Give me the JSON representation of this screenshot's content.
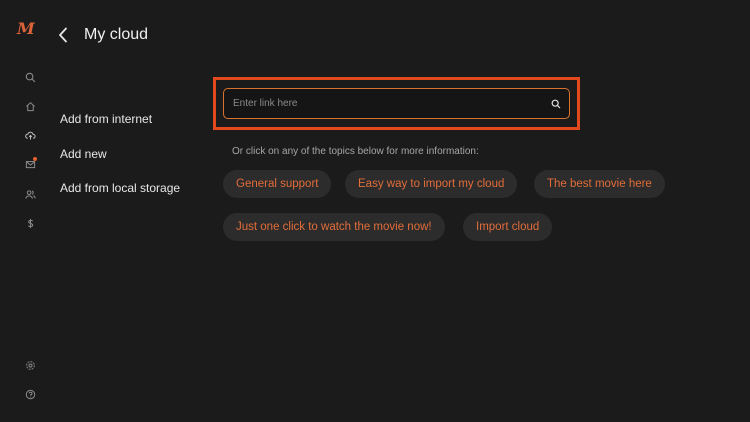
{
  "header": {
    "title": "My cloud"
  },
  "menu": {
    "items": [
      {
        "label": "Add from internet"
      },
      {
        "label": "Add new"
      },
      {
        "label": "Add from local storage"
      }
    ]
  },
  "search": {
    "placeholder": "Enter link here",
    "value": ""
  },
  "hint": "Or click on any of the topics below for more information:",
  "topics": [
    {
      "label": "General support"
    },
    {
      "label": "Easy way to import my cloud"
    },
    {
      "label": "The best movie here"
    },
    {
      "label": "Just one click to watch the movie now!"
    },
    {
      "label": "Import cloud"
    }
  ],
  "rail": {
    "logo": "M",
    "icons": [
      "search-icon",
      "home-icon",
      "cloud-upload-icon",
      "mail-icon",
      "users-icon",
      "dollar-icon",
      "settings-icon",
      "help-icon"
    ]
  },
  "colors": {
    "accent": "#e26d3a",
    "highlight": "#e24a1e",
    "background": "#1b1b1b",
    "chip_bg": "#2c2c2c"
  }
}
